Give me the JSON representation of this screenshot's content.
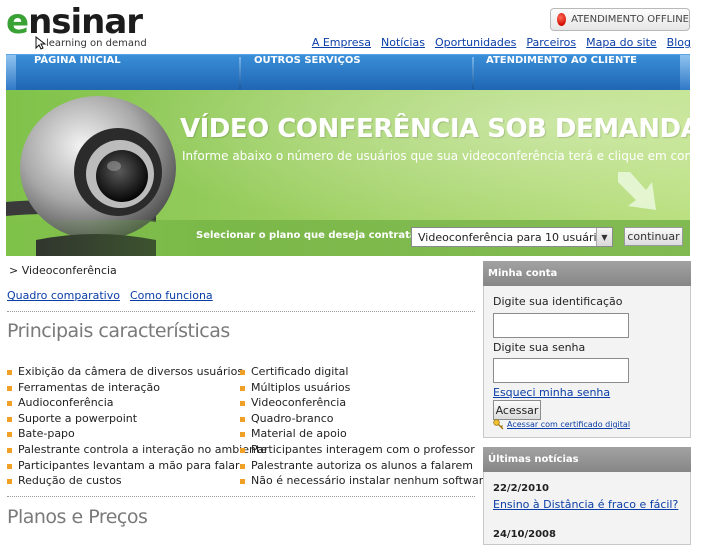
{
  "brand": {
    "logo_text_e": "e",
    "logo_text_rest": "nsinar",
    "tagline": "learning on demand"
  },
  "status": {
    "label": "ATENDIMENTO OFFLINE"
  },
  "top_links": [
    "A Empresa",
    "Notícias",
    "Oportunidades",
    "Parceiros",
    "Mapa do site",
    "Blog"
  ],
  "nav": {
    "items": [
      "PÁGINA INICIAL",
      "OUTROS SERVIÇOS",
      "ATENDIMENTO AO CLIENTE"
    ]
  },
  "banner": {
    "title": "VÍDEO CONFERÊNCIA SOB DEMANDA",
    "subtitle": "Informe abaixo o número de usuários que sua videoconferência terá e clique em continuar.",
    "plan_label": "Selecionar o plano que deseja contratar",
    "plan_selected": "Videoconferência para 10 usuários",
    "continue_label": "continuar"
  },
  "breadcrumb": "> Videoconferência",
  "sublinks": [
    "Quadro comparativo",
    "Como funciona"
  ],
  "sections": {
    "features_title": "Principais características",
    "plans_title": "Planos e Preços"
  },
  "features": {
    "left": [
      "Exibição da câmera de diversos usuários",
      "Ferramentas de interação",
      "Audioconferência",
      "Suporte a powerpoint",
      "Bate-papo",
      "Palestrante controla a interação no ambiente",
      "Participantes levantam a mão para falar",
      "Redução de custos"
    ],
    "right": [
      "Certificado digital",
      "Múltiplos usuários",
      "Videoconferência",
      "Quadro-branco",
      "Material de apoio",
      "Participantes interagem com o professor",
      "Palestrante autoriza os alunos a falarem",
      "Não é necessário instalar nenhum software"
    ]
  },
  "account": {
    "title": "Minha conta",
    "id_label": "Digite sua identificação",
    "id_value": "",
    "password_label": "Digite sua senha",
    "password_value": "",
    "forgot_label": "Esqueci minha senha",
    "access_label": "Acessar",
    "cert_label": "Acessar com certificado digital"
  },
  "news": {
    "title": "Últimas notícias",
    "items": [
      {
        "date": "22/2/2010",
        "title": "Ensino à Distância é fraco e fácil?"
      },
      {
        "date": "24/10/2008",
        "title": ""
      }
    ]
  },
  "colors": {
    "nav_blue": "#2a78c8",
    "banner_green": "#8cc854",
    "bullet_orange": "#f0a024",
    "link_blue": "#0a3ea6",
    "panel_gray": "#949494"
  }
}
